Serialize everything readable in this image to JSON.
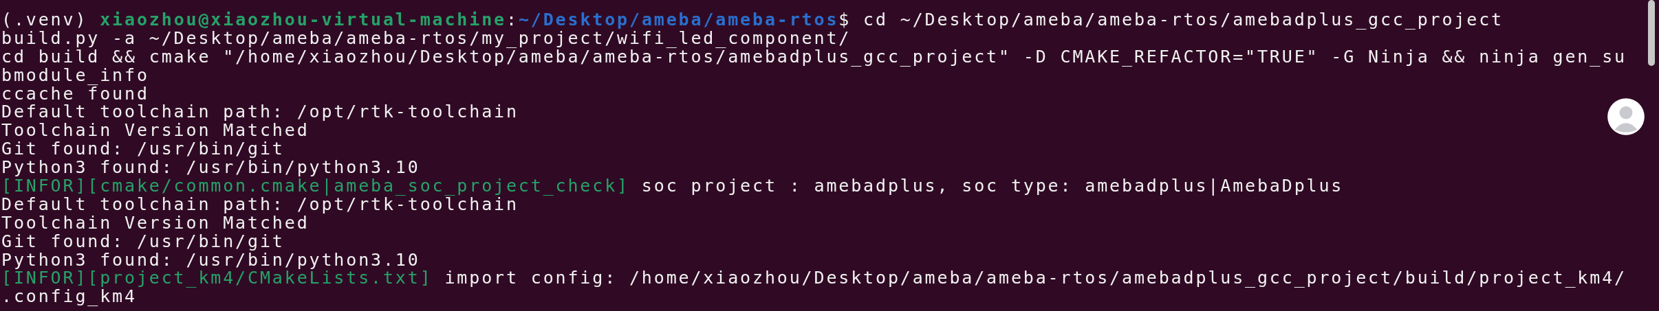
{
  "terminal": {
    "lines": [
      [
        {
          "kind": "plain",
          "text": "(.venv) "
        },
        {
          "kind": "user",
          "text": "xiaozhou@xiaozhou-virtual-machine"
        },
        {
          "kind": "plain",
          "text": ":"
        },
        {
          "kind": "path",
          "text": "~/Desktop/ameba/ameba-rtos"
        },
        {
          "kind": "plain",
          "text": "$ cd ~/Desktop/ameba/ameba-rtos/amebadplus_gcc_project"
        }
      ],
      [
        {
          "kind": "plain",
          "text": "build.py -a ~/Desktop/ameba/ameba-rtos/my_project/wifi_led_component/"
        }
      ],
      [
        {
          "kind": "plain",
          "text": "cd build && cmake \"/home/xiaozhou/Desktop/ameba/ameba-rtos/amebadplus_gcc_project\" -D CMAKE_REFACTOR=\"TRUE\" -G Ninja && ninja gen_su"
        }
      ],
      [
        {
          "kind": "plain",
          "text": "bmodule_info"
        }
      ],
      [
        {
          "kind": "plain",
          "text": "ccache found"
        }
      ],
      [
        {
          "kind": "plain",
          "text": "Default toolchain path: /opt/rtk-toolchain"
        }
      ],
      [
        {
          "kind": "plain",
          "text": "Toolchain Version Matched"
        }
      ],
      [
        {
          "kind": "plain",
          "text": "Git found: /usr/bin/git"
        }
      ],
      [
        {
          "kind": "plain",
          "text": "Python3 found: /usr/bin/python3.10"
        }
      ],
      [
        {
          "kind": "info",
          "text": "[INFOR][cmake/common.cmake|ameba_soc_project_check]"
        },
        {
          "kind": "plain",
          "text": " soc project : amebadplus, soc type: amebadplus|AmebaDplus"
        }
      ],
      [
        {
          "kind": "plain",
          "text": "Default toolchain path: /opt/rtk-toolchain"
        }
      ],
      [
        {
          "kind": "plain",
          "text": "Toolchain Version Matched"
        }
      ],
      [
        {
          "kind": "plain",
          "text": "Git found: /usr/bin/git"
        }
      ],
      [
        {
          "kind": "plain",
          "text": "Python3 found: /usr/bin/python3.10"
        }
      ],
      [
        {
          "kind": "info",
          "text": "[INFOR][project_km4/CMakeLists.txt]"
        },
        {
          "kind": "plain",
          "text": " import config: /home/xiaozhou/Desktop/ameba/ameba-rtos/amebadplus_gcc_project/build/project_km4/"
        }
      ],
      [
        {
          "kind": "plain",
          "text": ".config_km4"
        }
      ]
    ]
  }
}
